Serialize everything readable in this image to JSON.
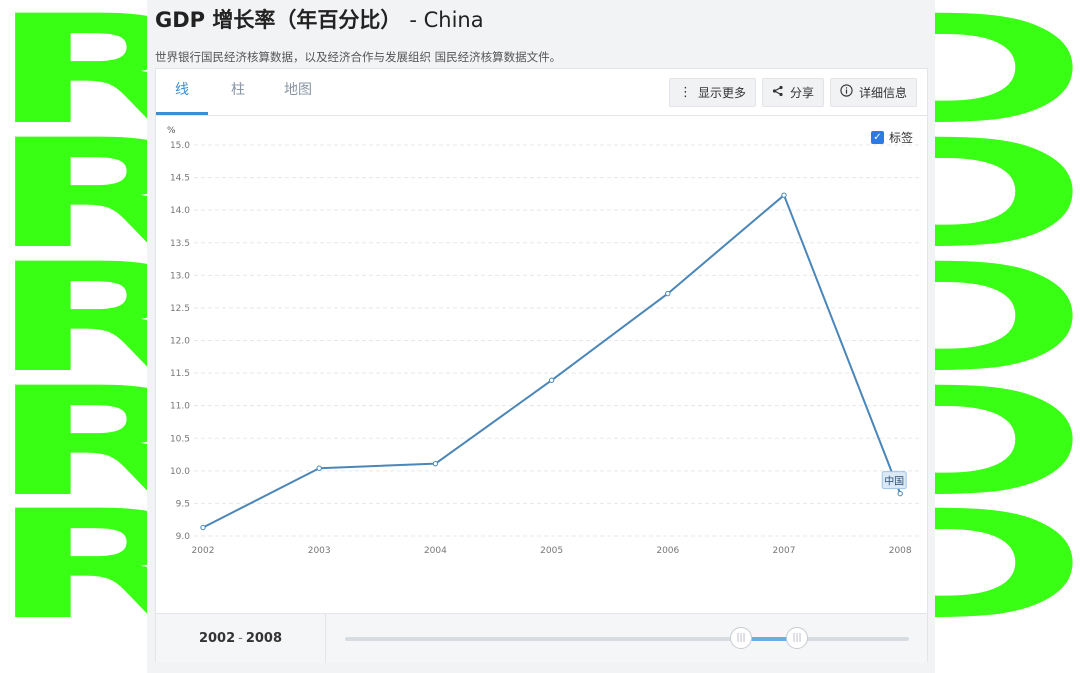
{
  "title": {
    "main": "GDP 增长率（年百分比）",
    "country": "- China"
  },
  "source": "世界银行国民经济核算数据，以及经济合作与发展组织 国民经济核算数据文件。",
  "tabs": [
    {
      "label": "线"
    },
    {
      "label": "柱"
    },
    {
      "label": "地图"
    }
  ],
  "toolbar": {
    "more_label": "显示更多",
    "share_label": "分享",
    "details_label": "详细信息"
  },
  "labels_toggle": {
    "label": "标签",
    "checked": true
  },
  "footer": {
    "range_start": "2002",
    "range_sep": "-",
    "range_end": "2008"
  },
  "background": {
    "word": "ROLLD",
    "color": "#39ff14"
  },
  "colors": {
    "line": "#4a86b8",
    "accent": "#3d8fd1"
  },
  "chart_data": {
    "type": "line",
    "x": [
      "2002",
      "2003",
      "2004",
      "2005",
      "2006",
      "2007",
      "2008"
    ],
    "series": [
      {
        "name": "中国",
        "values": [
          9.13,
          10.04,
          10.11,
          11.39,
          12.72,
          14.23,
          9.65
        ]
      }
    ],
    "ylabel": "%",
    "ylim": [
      9.0,
      15.0
    ],
    "yticks": [
      "9.0",
      "9.5",
      "10.0",
      "10.5",
      "11.0",
      "11.5",
      "12.0",
      "12.5",
      "13.0",
      "13.5",
      "14.0",
      "14.5",
      "15.0"
    ],
    "grid": true
  }
}
